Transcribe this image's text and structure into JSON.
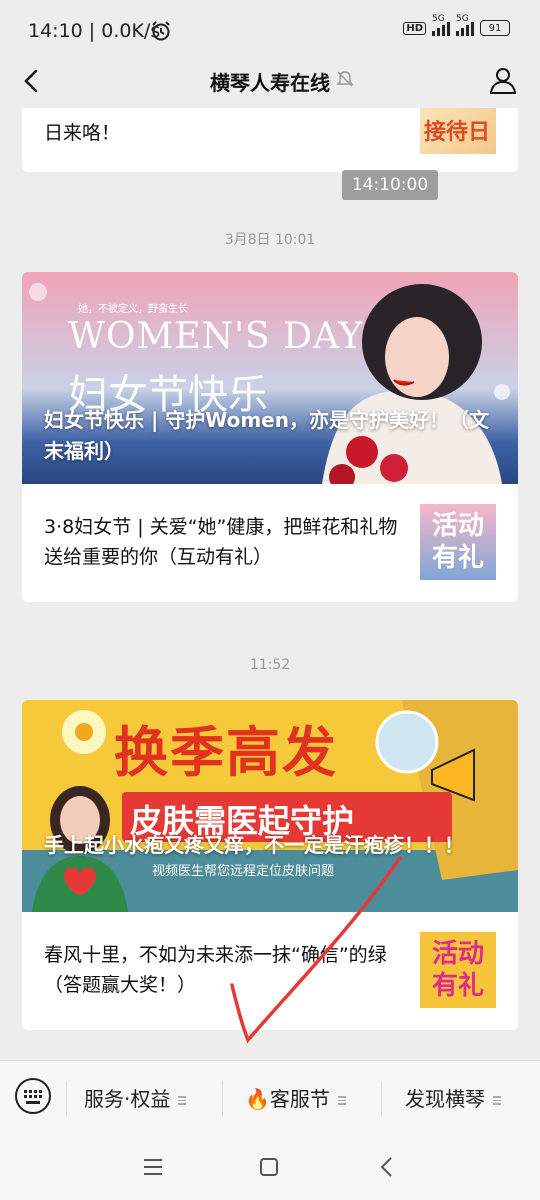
{
  "status_bar": {
    "time": "14:10 | 0.0K/s",
    "network_1": "5G",
    "network_2": "5G",
    "battery": "91",
    "hd_badge": "HD"
  },
  "nav": {
    "title": "横琴人寿在线"
  },
  "messages": {
    "partial_card": {
      "text": "日来咯！",
      "thumb_text": "接待日"
    },
    "tooltip_time": "14:10:00",
    "group1": {
      "timestamp": "3月8日 10:01",
      "banner_overlay_top": "她，不被定义，野蛮生长",
      "banner_en": "WOMEN'S DAY",
      "banner_cn": "妇女节快乐",
      "main_title": "妇女节快乐 | 守护Women，亦是守护美好！（文末福利）",
      "sub_title": "3·8妇女节 | 关爱“她”健康，把鲜花和礼物送给重要的你（互动有礼）",
      "sub_thumb_text": "活动有礼"
    },
    "group2": {
      "timestamp": "11:52",
      "banner_big": "换季高发",
      "banner_mid": "皮肤需医起守护",
      "banner_small": "视频医生帮您远程定位皮肤问题",
      "main_title": "手上起小水疱又疼又痒，不一定是汗疱疹！！！",
      "sub_title": "春风十里，不如为未来添一抹“确信”的绿（答题赢大奖！）",
      "sub_thumb_text": "活动有礼"
    }
  },
  "menu": {
    "item1": "服务·权益",
    "item2": "客服节",
    "item2_emoji": "🔥",
    "item3": "发现横琴"
  },
  "colors": {
    "background": "#ededed",
    "card": "#ffffff",
    "accent_red": "#e53935"
  }
}
